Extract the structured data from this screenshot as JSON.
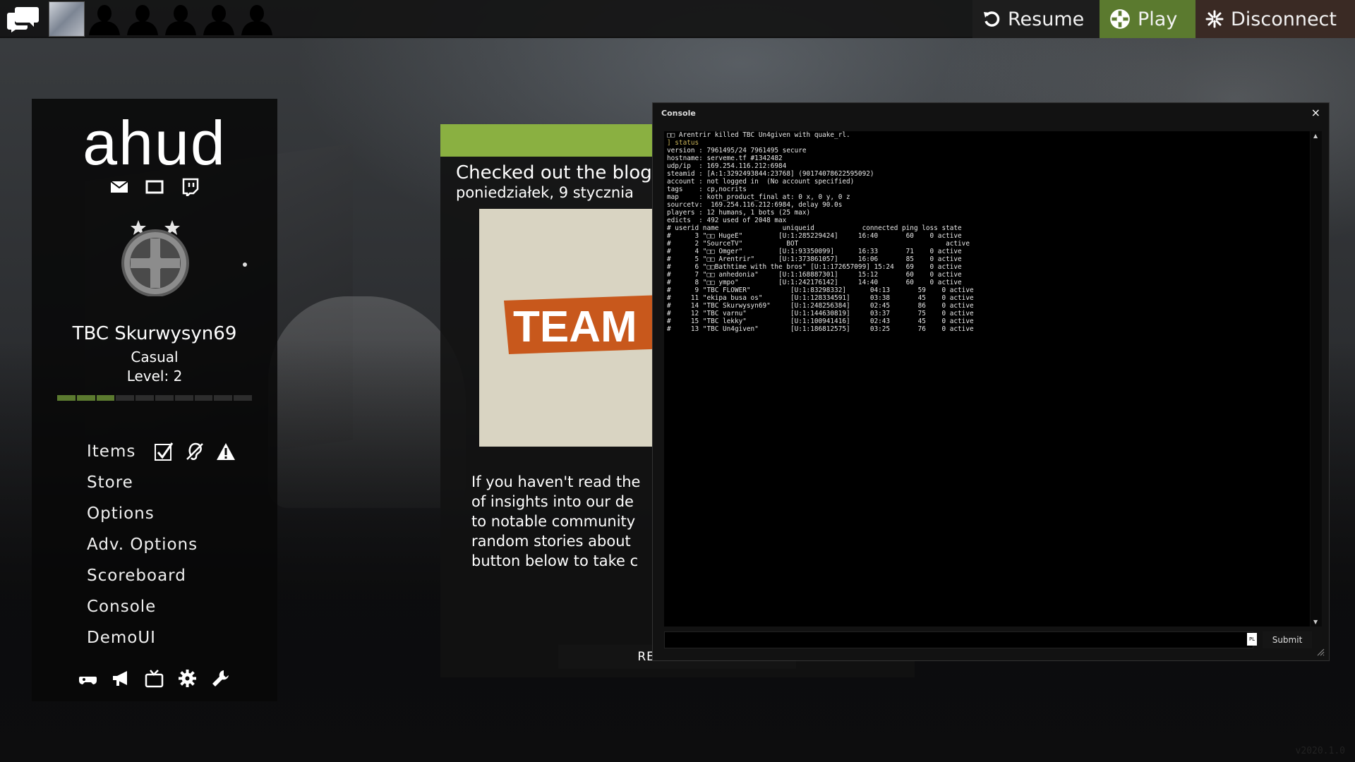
{
  "topbar": {
    "chat_icon": "chat-bubbles-icon",
    "friend_slots": 5,
    "resume_label": "Resume",
    "play_label": "Play",
    "disconnect_label": "Disconnect",
    "colors": {
      "play": "#5b7a2f",
      "disconnect": "#3a2a24"
    }
  },
  "sidebar": {
    "logo": "ahud",
    "player_name": "TBC Skurwysyn69",
    "mode": "Casual",
    "level_text": "Level: 2",
    "xp_segments_total": 10,
    "xp_segments_filled": 3,
    "menu": [
      {
        "label": "Items"
      },
      {
        "label": "Store"
      },
      {
        "label": "Options"
      },
      {
        "label": "Adv. Options"
      },
      {
        "label": "Scoreboard"
      },
      {
        "label": "Console"
      },
      {
        "label": "DemoUI"
      }
    ],
    "social_icons": [
      "mail-icon",
      "monitor-icon",
      "twitch-icon"
    ],
    "item_icons": [
      "checkbox-icon",
      "no-hearing-icon",
      "warning-icon"
    ],
    "bottom_icons": [
      "controller-icon",
      "megaphone-icon",
      "tv-icon",
      "gear-icon",
      "wrench-icon"
    ]
  },
  "blog": {
    "title": "Checked out the blog",
    "date": "poniedziałek, 9 stycznia",
    "lines": [
      "If you haven't read the",
      "of insights into our de",
      "to notable community",
      "random stories about",
      "button below to take c"
    ],
    "image_text": "TEAM FO",
    "read_more_label": "READ MORE",
    "header_color": "#8ab041"
  },
  "console": {
    "title": "Console",
    "close_label": "×",
    "lines": [
      "□□ Arentrir killed TBC Un4given with quake_rl.",
      "] status",
      "version : 7961495/24 7961495 secure",
      "hostname: serveme.tf #1342482",
      "udp/ip  : 169.254.116.212:6984",
      "steamid : [A:1:3292493844:23768] (90174078622595092)",
      "account : not logged in  (No account specified)",
      "tags    : cp,nocrits",
      "map     : koth_product_final at: 0 x, 0 y, 0 z",
      "sourcetv:  169.254.116.212:6984, delay 90.0s",
      "players : 12 humans, 1 bots (25 max)",
      "edicts  : 492 used of 2048 max",
      "# userid name                uniqueid            connected ping loss state",
      "#      3 \"□□ HugeE\"         [U:1:285229424]     16:40       60    0 active",
      "#      2 \"SourceTV\"           BOT                                     active",
      "#      4 \"□□ Omger\"         [U:1:93350099]      16:33       71    0 active",
      "#      5 \"□□ Arentrir\"      [U:1:373861057]     16:06       85    0 active",
      "#      6 \"□□Bathtime with the bros\" [U:1:172657099] 15:24   69    0 active",
      "#      7 \"□□ anhedonia\"     [U:1:168887301]     15:12       60    0 active",
      "#      8 \"□□ ympo\"          [U:1:242176142]     14:40       60    0 active",
      "#      9 \"TBC FLOWER\"          [U:1:83298332]      04:13       59    0 active",
      "#     11 \"ekipa busa os\"       [U:1:128334591]     03:38       45    0 active",
      "#     14 \"TBC Skurwysyn69\"     [U:1:248256384]     02:45       86    0 active",
      "#     12 \"TBC varnu\"           [U:1:144630819]     03:37       75    0 active",
      "#     15 \"TBC lekky\"           [U:1:100941416]     02:43       45    0 active",
      "#     13 \"TBC Un4given\"        [U:1:186812575]     03:25       76    0 active"
    ],
    "input_value": "",
    "lang_badge": "PL",
    "submit_label": "Submit"
  },
  "version": "v2020.1.0"
}
